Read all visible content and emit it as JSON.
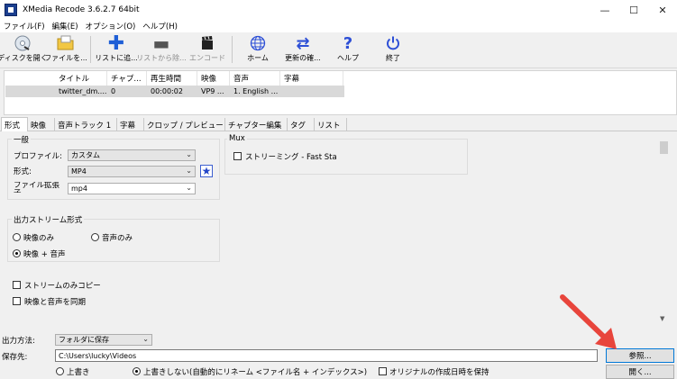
{
  "window": {
    "title": "XMedia Recode 3.6.2.7 64bit",
    "controls": [
      "—",
      "☐",
      "✕"
    ]
  },
  "menu": [
    "ファイル(F)",
    "編集(E)",
    "オプション(O)",
    "ヘルプ(H)"
  ],
  "toolbar": {
    "open_disc": "ディスクを開く",
    "open_file": "ファイルを...",
    "add_to_list": "リストに追...",
    "remove_from_list": "リストから除...",
    "encode": "エンコード",
    "home": "ホーム",
    "update": "更新の確...",
    "help": "ヘルプ",
    "exit": "終了"
  },
  "filelist": {
    "headers": [
      "タイトル",
      "チャプ...",
      "再生時間",
      "映像",
      "音声",
      "字幕"
    ],
    "row": [
      "twitter_dm....",
      "0",
      "00:00:02",
      "VP9 ...",
      "1. English ...",
      ""
    ]
  },
  "tabs": [
    "形式",
    "映像",
    "音声トラック 1",
    "字幕",
    "クロップ / プレビュー",
    "チャプター編集",
    "タグ",
    "リスト"
  ],
  "general": {
    "title": "一般",
    "profile_label": "プロファイル:",
    "profile_value": "カスタム",
    "format_label": "形式:",
    "format_value": "MP4",
    "ext_label": "ファイル拡張子",
    "ext_value": "mp4"
  },
  "mux": {
    "title": "Mux",
    "streaming": "ストリーミング - Fast Sta"
  },
  "output_stream": {
    "title": "出力ストリーム形式",
    "video_only": "映像のみ",
    "audio_only": "音声のみ",
    "video_audio": "映像 + 音声"
  },
  "options": {
    "stream_copy": "ストリームのみコピー",
    "sync_av": "映像と音声を同期"
  },
  "output": {
    "method_label": "出力方法:",
    "method_value": "フォルダに保存",
    "dest_label": "保存先:",
    "dest_value": "C:\\Users\\lucky\\Videos",
    "browse": "参照...",
    "open": "開く...",
    "overwrite": "上書き",
    "no_overwrite": "上書きしない(自動的にリネーム <ファイル名 + インデックス>)",
    "keep_date": "オリジナルの作成日時を保持"
  },
  "colors": {
    "annotation_arrow": "#e8453c",
    "accent": "#0078d7"
  }
}
